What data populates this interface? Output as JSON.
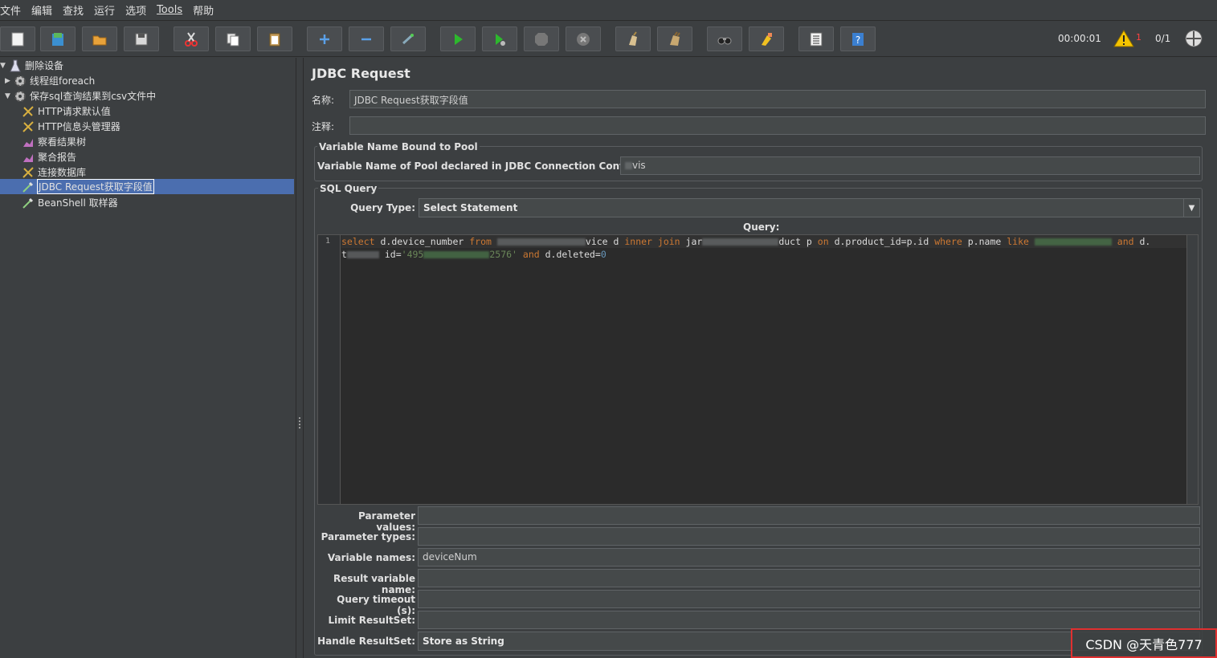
{
  "menu": [
    "文件",
    "编辑",
    "查找",
    "运行",
    "选项",
    "Tools",
    "帮助"
  ],
  "toolbar": {
    "timer": "00:00:01",
    "warning_count": "1",
    "threads": "0/1"
  },
  "tree": [
    {
      "label": "删除设备",
      "icon": "flask-icon",
      "expanded": true
    },
    {
      "label": "线程组foreach",
      "icon": "gear-icon",
      "expanded": false
    },
    {
      "label": "保存sql查询结果到csv文件中",
      "icon": "gear-icon",
      "expanded": true
    },
    {
      "label": "HTTP请求默认值",
      "icon": "wrench-icon"
    },
    {
      "label": "HTTP信息头管理器",
      "icon": "wrench-icon"
    },
    {
      "label": "察看结果树",
      "icon": "chart-icon"
    },
    {
      "label": "聚合报告",
      "icon": "chart-icon"
    },
    {
      "label": "连接数据库",
      "icon": "wrench-icon"
    },
    {
      "label": "JDBC Request获取字段值",
      "icon": "pipette-icon",
      "selected": true
    },
    {
      "label": "BeanShell 取样器",
      "icon": "pipette-icon"
    }
  ],
  "panel": {
    "title": "JDBC Request",
    "name_label": "名称:",
    "name_value": "JDBC Request获取字段值",
    "comment_label": "注释:",
    "comment_value": "",
    "pool_group": "Variable Name Bound to Pool",
    "pool_label": "Variable Name of Pool declared in JDBC Connection Configuration:",
    "pool_value": "vis",
    "sql_group": "SQL Query",
    "query_type_label": "Query Type:",
    "query_type_value": "Select Statement",
    "query_label": "Query:",
    "line_number": "1",
    "code": {
      "l1_a": "select",
      "l1_b": " d.device_number ",
      "l1_c": "from",
      "l1_d": "vice d ",
      "l1_e": "inner join",
      "l1_f": " jar",
      "l1_g": "duct p ",
      "l1_h": "on",
      "l1_i": " d.product_id=p.id ",
      "l1_j": "where",
      "l1_k": "  p.name ",
      "l1_l": "like",
      "l1_m": "and",
      "l1_n": " d.",
      "l2_a": "t",
      "l2_b": " id=",
      "l2_c": "'495",
      "l2_d": "2576'",
      "l2_e": "and",
      "l2_f": " d.deleted=",
      "l2_g": "0"
    },
    "params": [
      {
        "label": "Parameter values:",
        "value": ""
      },
      {
        "label": "Parameter types:",
        "value": ""
      },
      {
        "label": "Variable names:",
        "value": "deviceNum"
      },
      {
        "label": "Result variable name:",
        "value": ""
      },
      {
        "label": "Query timeout (s):",
        "value": ""
      },
      {
        "label": "Limit ResultSet:",
        "value": ""
      },
      {
        "label": "Handle ResultSet:",
        "value": "Store as String"
      }
    ]
  },
  "watermark": "CSDN @天青色777"
}
